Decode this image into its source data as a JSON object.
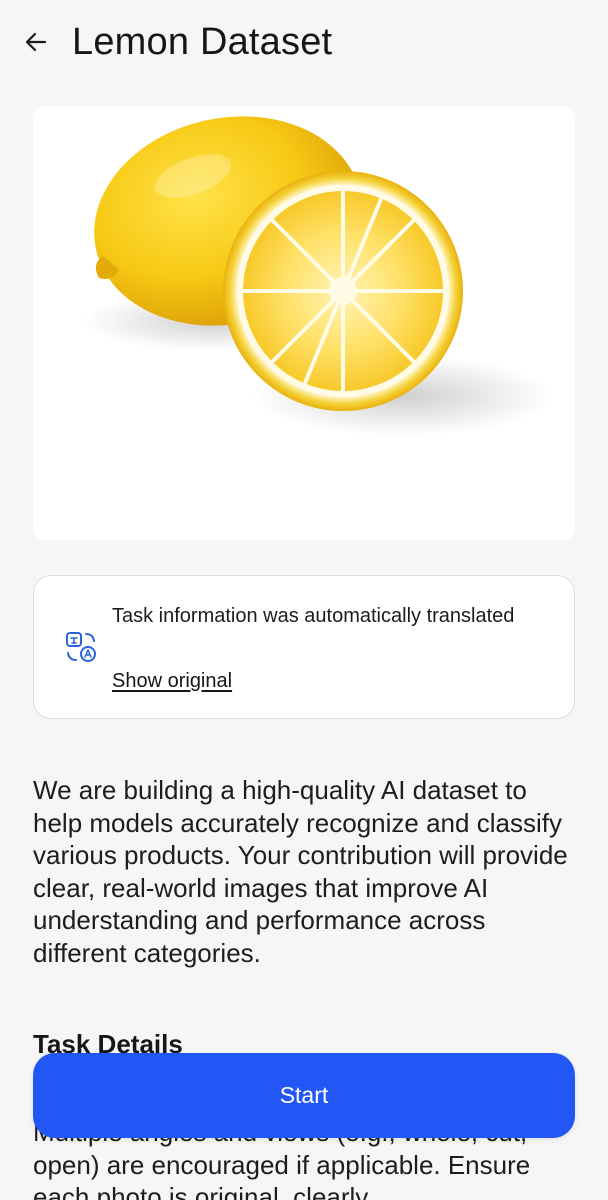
{
  "header": {
    "title": "Lemon Dataset",
    "back_icon": "arrow-left-icon"
  },
  "hero": {
    "image_subject": "lemon-and-half-lemon"
  },
  "notice": {
    "icon": "translate-icon",
    "message": "Task information was automatically translated",
    "link_label": "Show original"
  },
  "description": "We are building a high-quality AI dataset to help models accurately recognize and classify various products. Your contribution will provide clear, real-world images that improve AI understanding and performance across different categories.",
  "task_details": {
    "heading": "Task Details",
    "body": "Multiple angles and views (e.g., whole, cut, open) are encouraged if applicable. Ensure each photo is original, clearly"
  },
  "actions": {
    "start_label": "Start"
  },
  "colors": {
    "accent": "#2357f5",
    "background": "#f6f6f6",
    "icon_blue": "#2b63d9"
  }
}
